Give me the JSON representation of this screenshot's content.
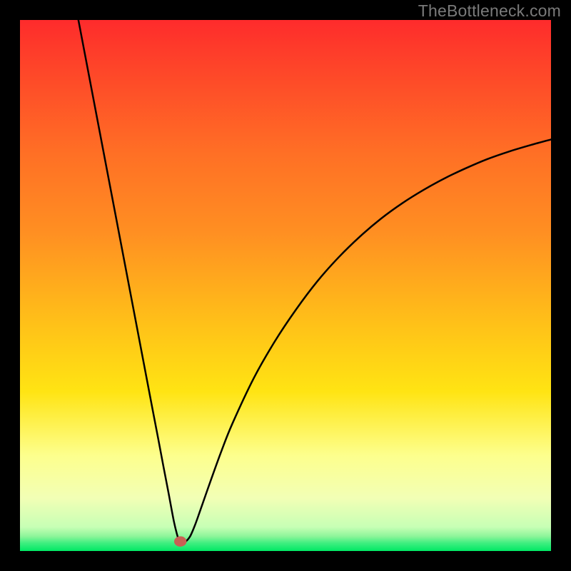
{
  "watermark": "TheBottleneck.com",
  "chart_data": {
    "type": "line",
    "title": "",
    "xlabel": "",
    "ylabel": "",
    "xlim": [
      0,
      100
    ],
    "ylim": [
      0,
      100
    ],
    "grid": false,
    "legend": false,
    "gradient_colors": {
      "top": "#fe2b2c",
      "mid1": "#ff8f22",
      "mid2": "#ffe413",
      "mid3": "#fdff8d",
      "bottom": "#00e864"
    },
    "marker": {
      "x": 30.2,
      "y": 1.8,
      "color": "#c86054",
      "radius": 1.3
    },
    "series": [
      {
        "name": "bottleneck-curve",
        "color": "#000000",
        "x": [
          11.0,
          13.0,
          15.0,
          17.0,
          19.0,
          21.0,
          23.0,
          25.0,
          26.0,
          27.0,
          28.0,
          28.5,
          29.0,
          29.5,
          30.0,
          30.5,
          31.0,
          32.0,
          33.0,
          34.0,
          36.0,
          38.0,
          40.0,
          44.0,
          48.0,
          52.0,
          56.0,
          60.0,
          64.0,
          68.0,
          72.0,
          76.0,
          80.0,
          84.0,
          88.0,
          92.0,
          96.0,
          100.0
        ],
        "y": [
          100.0,
          89.5,
          79.0,
          68.5,
          58.0,
          47.5,
          37.0,
          26.5,
          21.3,
          16.0,
          10.8,
          8.1,
          5.5,
          3.4,
          1.8,
          1.5,
          1.6,
          2.7,
          5.0,
          7.8,
          13.5,
          19.0,
          24.0,
          32.5,
          39.5,
          45.5,
          50.8,
          55.3,
          59.2,
          62.6,
          65.5,
          68.0,
          70.2,
          72.1,
          73.8,
          75.2,
          76.4,
          77.5
        ]
      }
    ]
  }
}
